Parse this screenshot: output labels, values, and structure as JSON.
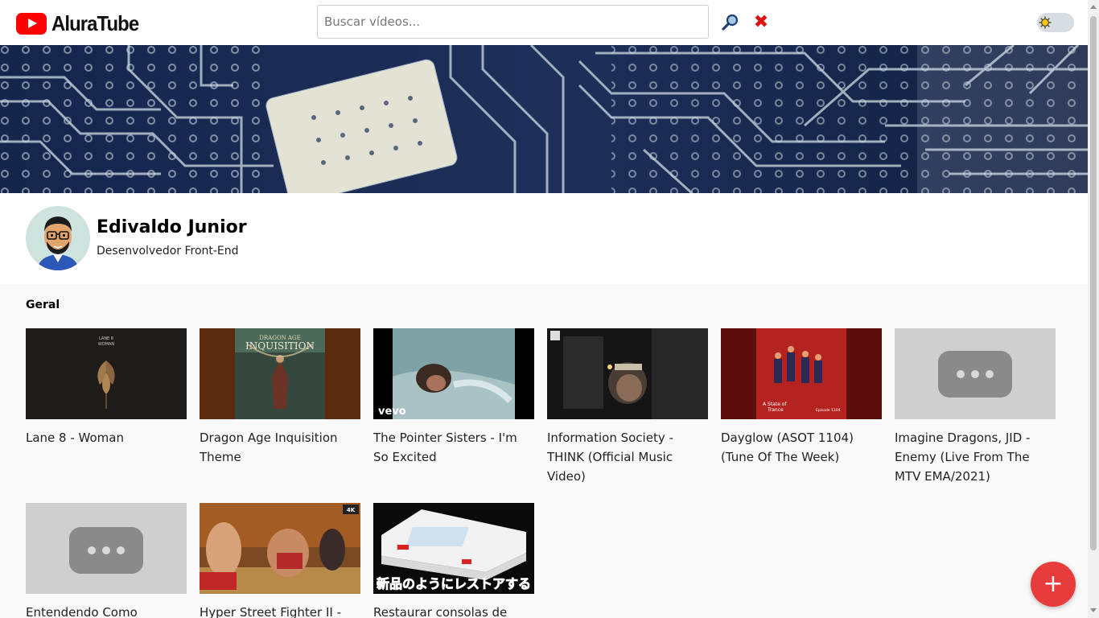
{
  "header": {
    "logo_text": "AluraTube",
    "search_placeholder": "Buscar vídeos...",
    "clear_icon": "✖"
  },
  "banner": {
    "alt": "circuit-board-banner"
  },
  "profile": {
    "name": "Edivaldo Junior",
    "role": "Desenvolvedor Front-End"
  },
  "section": {
    "title": "Geral"
  },
  "videos": [
    {
      "title": "Lane 8 - Woman"
    },
    {
      "title": "Dragon Age Inquisition Theme"
    },
    {
      "title": "The Pointer Sisters - I'm So Excited"
    },
    {
      "title": "Information Society - THINK (Official Music Video)"
    },
    {
      "title": "Dayglow (ASOT 1104) (Tune Of The Week)"
    },
    {
      "title": "Imagine Dragons, JID - Enemy (Live From The MTV EMA/2021)"
    },
    {
      "title": "Entendendo Como ChatGPT"
    },
    {
      "title": "Hyper Street Fighter II -"
    },
    {
      "title": "Restaurar consolas de jogos"
    }
  ],
  "thumb_text": {
    "lane8": "LANE 8\nWOMAN",
    "dragon_age_1": "DRAGON AGE",
    "dragon_age_2": "INQUISITION",
    "vevo": "vevo",
    "dayglow_1": "A State of",
    "dayglow_2": "Trance",
    "dayglow_3": "Episode 1104",
    "badge_4k": "4K",
    "japanese": "新品のようにレストアする"
  },
  "fab": {
    "label": "+"
  },
  "colors": {
    "brand_red": "#ff0000",
    "fab": "#e83b3b",
    "clear_red": "#d11111"
  }
}
